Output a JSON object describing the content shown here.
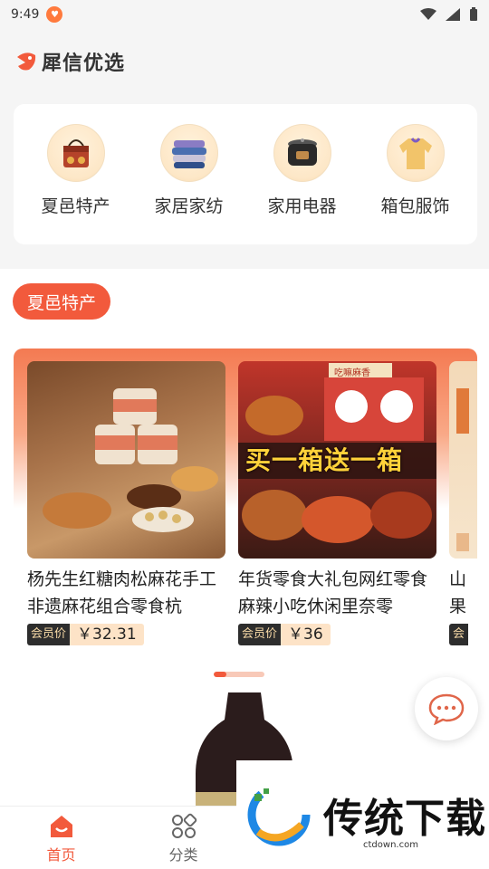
{
  "status": {
    "time": "9:49"
  },
  "header": {
    "title": "犀信优选"
  },
  "categories": [
    {
      "label": "夏邑特产",
      "icon": "gift-box-icon"
    },
    {
      "label": "家居家纺",
      "icon": "folded-towels-icon"
    },
    {
      "label": "家用电器",
      "icon": "pressure-cooker-icon"
    },
    {
      "label": "箱包服饰",
      "icon": "sweater-icon"
    }
  ],
  "section": {
    "title": "夏邑特产"
  },
  "products": [
    {
      "name": "杨先生红糖肉松麻花手工非遗麻花组合零食杭",
      "member_label": "会员价",
      "price": "￥32.31"
    },
    {
      "name": "年货零食大礼包网红零食麻辣小吃休闲里奈零",
      "member_label": "会员价",
      "price": "￥36",
      "banner": "买一箱送一箱",
      "badge": "吃嘛麻香"
    },
    {
      "name": "山果",
      "member_label": "会",
      "price": ""
    }
  ],
  "tabbar": {
    "items": [
      {
        "label": "首页"
      },
      {
        "label": "分类"
      }
    ]
  },
  "watermark": {
    "text": "传统下载",
    "url": "ctdown.com"
  },
  "colors": {
    "accent": "#f25a3c",
    "price_bg": "#fde3c7",
    "member_bg": "#2d2d2d"
  }
}
